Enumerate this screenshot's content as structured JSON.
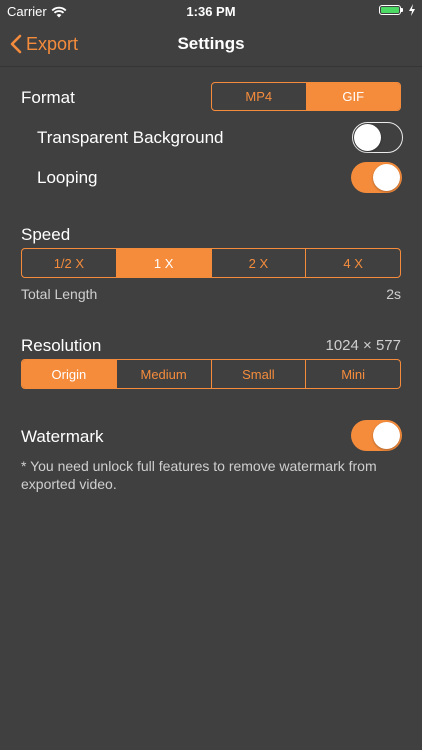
{
  "status_bar": {
    "carrier": "Carrier",
    "time": "1:36 PM",
    "battery_color": "#4cd964"
  },
  "nav": {
    "back_label": "Export",
    "title": "Settings"
  },
  "accent_color": "#f58c3c",
  "format": {
    "title": "Format",
    "options": [
      "MP4",
      "GIF"
    ],
    "selected": "GIF",
    "transparent_label": "Transparent Background",
    "transparent_on": false,
    "looping_label": "Looping",
    "looping_on": true
  },
  "speed": {
    "title": "Speed",
    "options": [
      "1/2 X",
      "1 X",
      "2 X",
      "4 X"
    ],
    "selected": "1 X",
    "total_length_label": "Total Length",
    "total_length_value": "2s"
  },
  "resolution": {
    "title": "Resolution",
    "value": "1024 × 577",
    "options": [
      "Origin",
      "Medium",
      "Small",
      "Mini"
    ],
    "selected": "Origin"
  },
  "watermark": {
    "title": "Watermark",
    "on": true,
    "note": "* You need unlock full features to remove watermark from exported video."
  }
}
